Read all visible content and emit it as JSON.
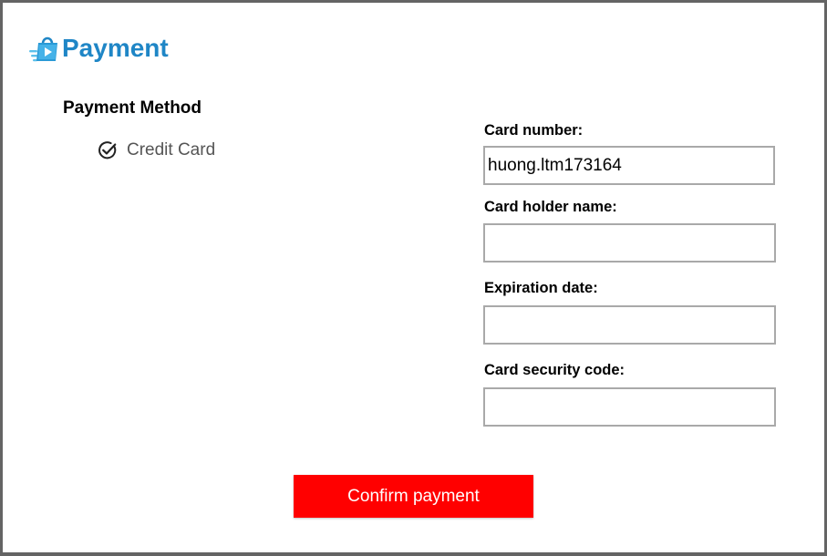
{
  "header": {
    "title": "Payment",
    "logo_icon": "shopping-bag-icon",
    "accent_color": "#1f86c6"
  },
  "payment_method": {
    "title": "Payment Method",
    "options": [
      {
        "label": "Credit Card",
        "icon": "check-circle-icon",
        "selected": true
      }
    ]
  },
  "form": {
    "card_number": {
      "label": "Card number:",
      "value": "huong.ltm173164"
    },
    "card_holder_name": {
      "label": "Card holder name:",
      "value": ""
    },
    "expiration_date": {
      "label": "Expiration date:",
      "value": ""
    },
    "security_code": {
      "label": "Card security code:",
      "value": ""
    }
  },
  "confirm_button": {
    "label": "Confirm payment",
    "color": "#ff0000"
  }
}
